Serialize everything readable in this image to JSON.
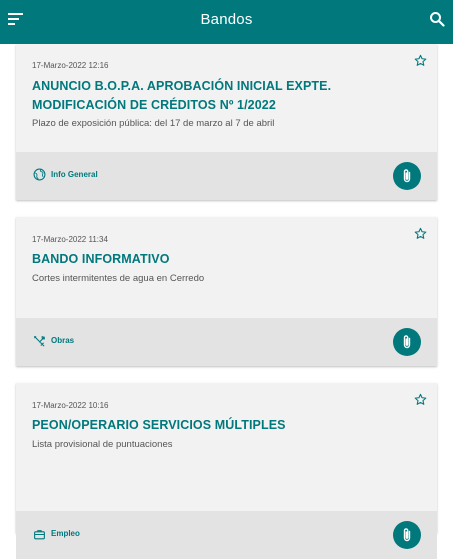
{
  "header": {
    "title": "Bandos",
    "menu_icon": "menu-icon",
    "search_icon": "search-icon",
    "color": "#00787c"
  },
  "items": [
    {
      "date": "17-Marzo-2022 12:16",
      "title": "ANUNCIO B.O.P.A. APROBACIÓN INICIAL EXPTE. MODIFICACIÓN DE CRÉDITOS Nº 1/2022",
      "description": "Plazo de exposición pública: del 17 de marzo al 7 de abril",
      "category": "Info General",
      "category_icon": "globe-icon"
    },
    {
      "date": "17-Marzo-2022 11:34",
      "title": "BANDO INFORMATIVO",
      "description": "Cortes intermitentes de agua en Cerredo",
      "category": "Obras",
      "category_icon": "tools-icon"
    },
    {
      "date": "17-Marzo-2022 10:16",
      "title": "PEON/OPERARIO SERVICIOS MÚLTIPLES",
      "description": "Lista provisional de puntuaciones",
      "category": "Empleo",
      "category_icon": "briefcase-icon"
    }
  ]
}
